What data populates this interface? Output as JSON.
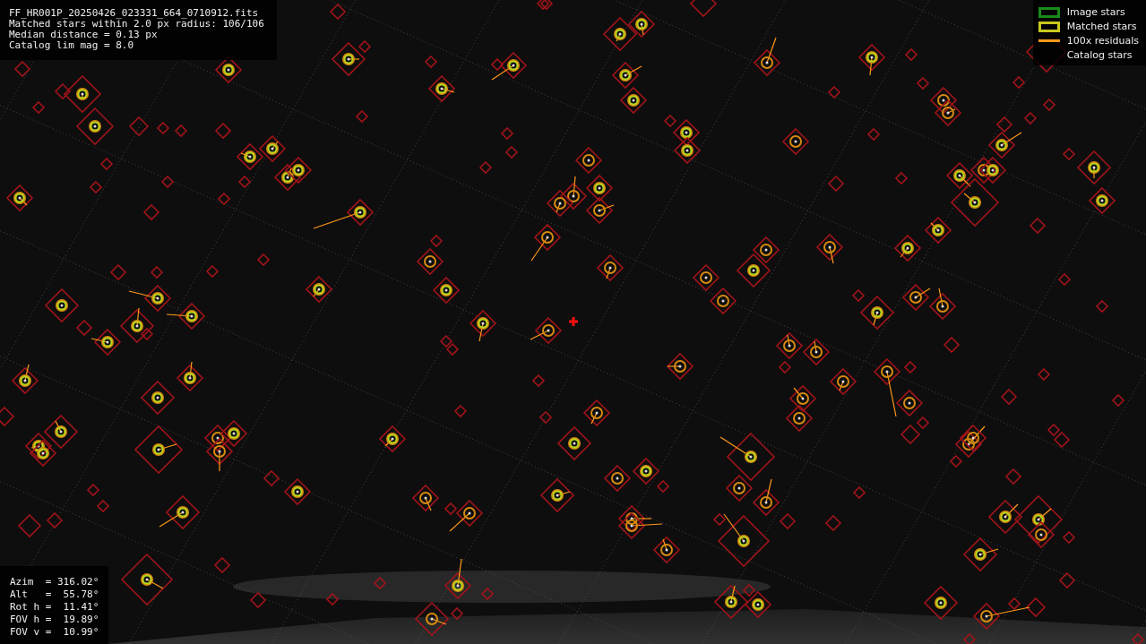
{
  "header": [
    "FF_HR001P_20250426_023331_664_0710912.fits",
    "Matched stars within 2.0 px radius: 106/106",
    "Median distance = 0.13 px",
    "Catalog lim mag = 8.0"
  ],
  "legend": [
    {
      "kind": "image",
      "label": "Image stars",
      "color": "#1a8a1a"
    },
    {
      "kind": "matched",
      "label": "Matched stars",
      "color": "#c8c820"
    },
    {
      "kind": "residual",
      "label": "100x residuals",
      "color": "#ff9a1a"
    },
    {
      "kind": "catalog",
      "label": "Catalog stars"
    }
  ],
  "pointing": [
    "Azim  = 316.02°",
    "Alt   =  55.78°",
    "Rot h =  11.41°",
    "FOV h =  19.89°",
    "FOV v =  10.99°"
  ]
}
